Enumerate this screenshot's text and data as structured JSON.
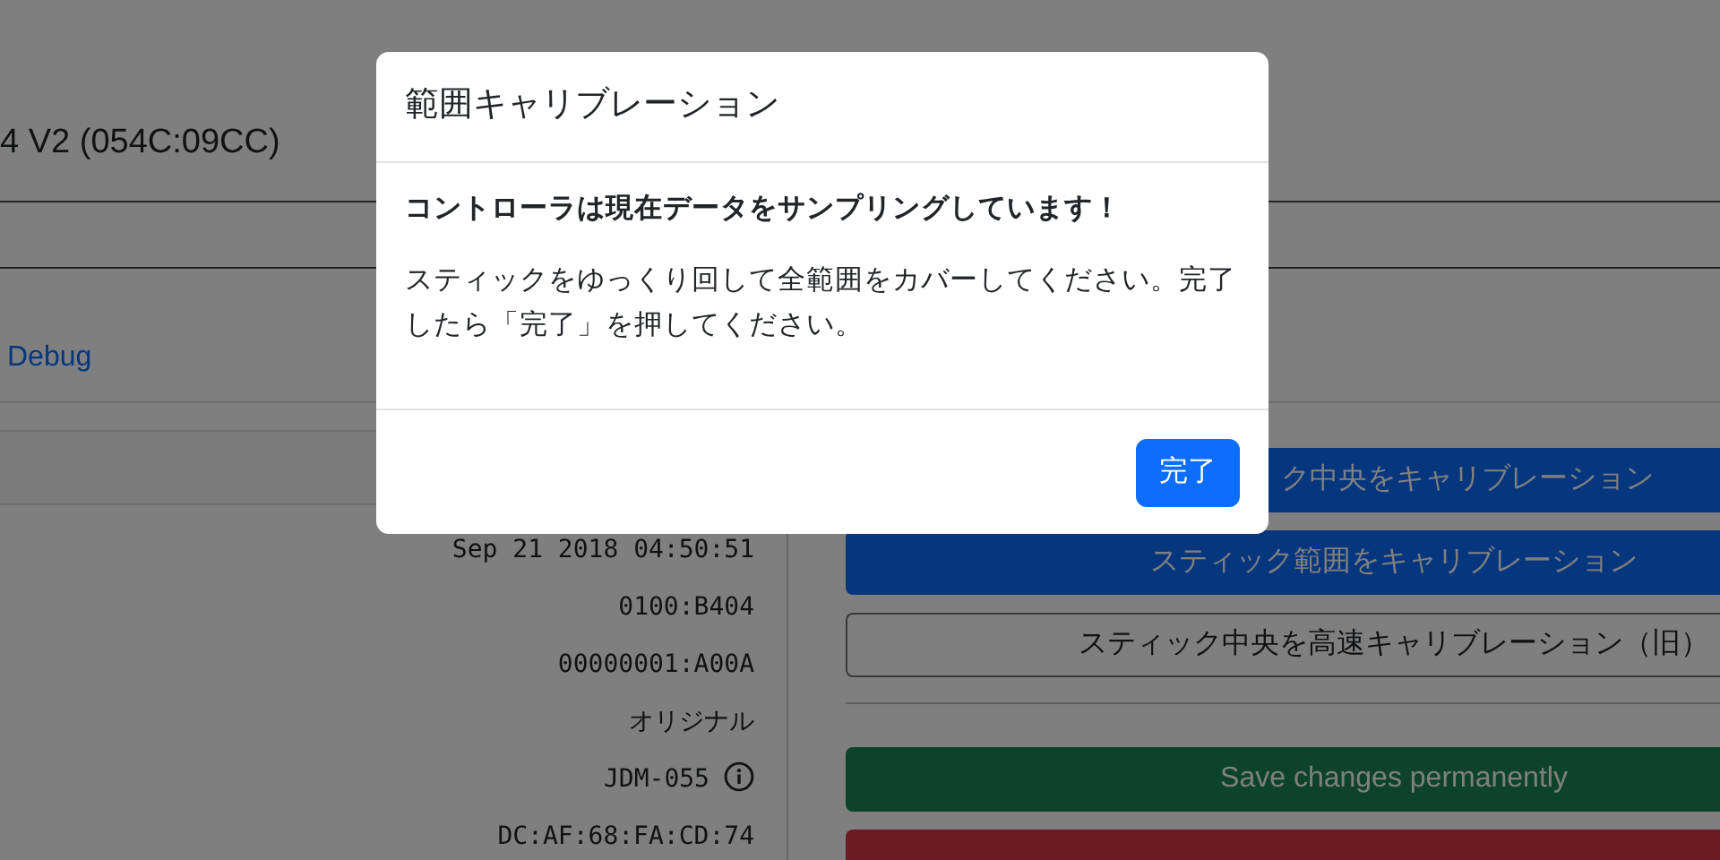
{
  "page": {
    "device_title": "4 V2 (054C:09CC)",
    "debug_link": "Debug",
    "info_values": [
      {
        "text": "Sep 21 2018 04:50:51",
        "info_icon": false
      },
      {
        "text": "0100:B404",
        "info_icon": false
      },
      {
        "text": "00000001:A00A",
        "info_icon": false
      },
      {
        "text": "オリジナル",
        "info_icon": false
      },
      {
        "text": "JDM-055",
        "info_icon": true
      },
      {
        "text": "DC:AF:68:FA:CD:74",
        "info_icon": false
      }
    ],
    "buttons": [
      {
        "label": "ク中央をキャリブレーション",
        "kind": "primary",
        "covered": true
      },
      {
        "label": "スティック範囲をキャリブレーション",
        "kind": "primary",
        "covered": false
      },
      {
        "label": "スティック中央を高速キャリブレーション（旧）",
        "kind": "outline",
        "covered": false
      },
      {
        "label": "Save changes permanently",
        "kind": "success",
        "covered": false
      }
    ],
    "lower_buttons": [
      {
        "kind": "danger"
      }
    ]
  },
  "modal": {
    "title": "範囲キャリブレーション",
    "lead": "コントローラは現在データをサンプリングしています！",
    "message": "スティックをゆっくり回して全範囲をカバーしてください。完了したら「完了」を押してください。",
    "button": "完了"
  }
}
